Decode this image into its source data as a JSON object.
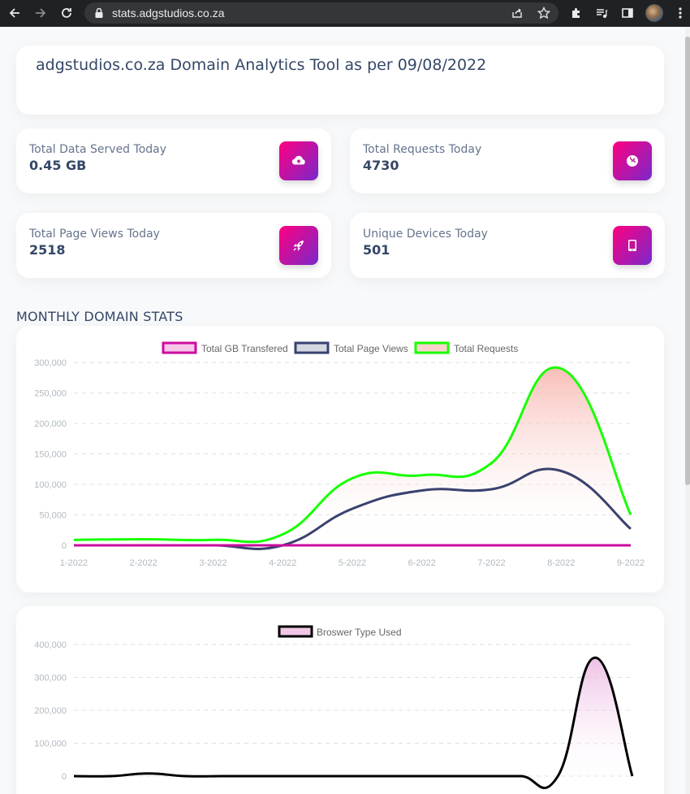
{
  "browser": {
    "url": "stats.adgstudios.co.za"
  },
  "header": {
    "title": "adgstudios.co.za Domain Analytics Tool as per 09/08/2022"
  },
  "stats": [
    {
      "label": "Total Data Served Today",
      "value": "0.45 GB",
      "icon": "cloud-upload-icon"
    },
    {
      "label": "Total Requests Today",
      "value": "4730",
      "icon": "globe-icon"
    },
    {
      "label": "Total Page Views Today",
      "value": "2518",
      "icon": "rocket-icon"
    },
    {
      "label": "Unique Devices Today",
      "value": "501",
      "icon": "tablet-icon"
    }
  ],
  "section_title": "MONTHLY DOMAIN STATS",
  "colors": {
    "gb": "#cb0c9f",
    "views": "#3a416f",
    "requests": "#17ff00",
    "browser": "#000000"
  },
  "chart_data": [
    {
      "type": "line",
      "categories": [
        "1-2022",
        "2-2022",
        "3-2022",
        "4-2022",
        "5-2022",
        "6-2022",
        "7-2022",
        "8-2022",
        "9-2022"
      ],
      "ylim": [
        0,
        300000
      ],
      "yticks": [
        "300,000",
        "250,000",
        "200,000",
        "150,000",
        "100,000",
        "50,000",
        "0"
      ],
      "ytick_values": [
        300000,
        250000,
        200000,
        150000,
        100000,
        50000,
        0
      ],
      "grid": true,
      "legend_position": "top",
      "series": [
        {
          "name": "Total GB Transfered",
          "values": [
            0,
            0,
            0,
            0,
            0,
            0,
            0,
            0,
            0
          ]
        },
        {
          "name": "Total Page Views",
          "values": [
            0,
            0,
            0,
            0,
            60000,
            90000,
            92000,
            122000,
            27000
          ]
        },
        {
          "name": "Total Requests",
          "values": [
            9000,
            10000,
            9000,
            18000,
            110000,
            115000,
            135000,
            290000,
            50000
          ]
        }
      ]
    },
    {
      "type": "line",
      "ylim": [
        0,
        400000
      ],
      "yticks": [
        "400,000",
        "300,000",
        "200,000",
        "100,000",
        "0"
      ],
      "ytick_values": [
        400000,
        300000,
        200000,
        100000,
        0
      ],
      "grid": true,
      "legend_position": "top",
      "series": [
        {
          "name": "Broswer Type Used",
          "values": [
            0,
            0,
            8000,
            0,
            0,
            0,
            0,
            0,
            0,
            0,
            0,
            0,
            0,
            0,
            360000,
            0
          ]
        }
      ]
    }
  ]
}
